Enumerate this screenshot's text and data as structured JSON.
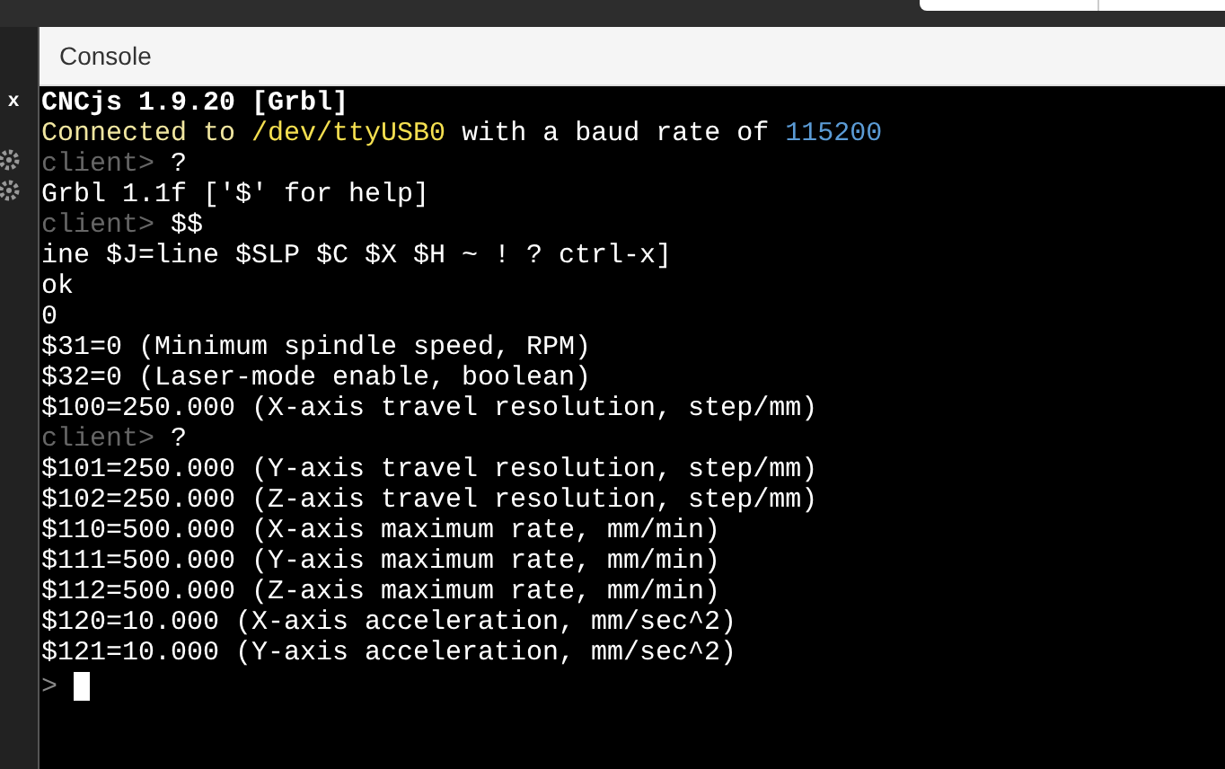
{
  "sidebar": {
    "close_label": "x"
  },
  "panel": {
    "title": "Console"
  },
  "console": {
    "lines": [
      {
        "segments": [
          {
            "kind": "banner",
            "text": "CNCjs 1.9.20 [Grbl]"
          }
        ]
      },
      {
        "segments": [
          {
            "kind": "info",
            "text": "Connected to "
          },
          {
            "kind": "path",
            "text": "/dev/ttyUSB0"
          },
          {
            "kind": "plain",
            "text": " with a baud rate of "
          },
          {
            "kind": "number",
            "text": "115200"
          }
        ]
      },
      {
        "segments": [
          {
            "kind": "prompt",
            "text": "client>"
          },
          {
            "kind": "plain",
            "text": " ?"
          }
        ]
      },
      {
        "segments": [
          {
            "kind": "plain",
            "text": "Grbl 1.1f ['$' for help]"
          }
        ]
      },
      {
        "segments": [
          {
            "kind": "prompt",
            "text": "client>"
          },
          {
            "kind": "plain",
            "text": " $$"
          }
        ]
      },
      {
        "segments": [
          {
            "kind": "plain",
            "text": "ine $J=line $SLP $C $X $H ~ ! ? ctrl-x]"
          }
        ]
      },
      {
        "segments": [
          {
            "kind": "plain",
            "text": "ok"
          }
        ]
      },
      {
        "segments": [
          {
            "kind": "plain",
            "text": "0"
          }
        ]
      },
      {
        "segments": [
          {
            "kind": "plain",
            "text": "$31=0 (Minimum spindle speed, RPM)"
          }
        ]
      },
      {
        "segments": [
          {
            "kind": "plain",
            "text": "$32=0 (Laser-mode enable, boolean)"
          }
        ]
      },
      {
        "segments": [
          {
            "kind": "plain",
            "text": "$100=250.000 (X-axis travel resolution, step/mm)"
          }
        ]
      },
      {
        "segments": [
          {
            "kind": "prompt",
            "text": "client>"
          },
          {
            "kind": "plain",
            "text": " ?"
          }
        ]
      },
      {
        "segments": [
          {
            "kind": "plain",
            "text": "$101=250.000 (Y-axis travel resolution, step/mm)"
          }
        ]
      },
      {
        "segments": [
          {
            "kind": "plain",
            "text": "$102=250.000 (Z-axis travel resolution, step/mm)"
          }
        ]
      },
      {
        "segments": [
          {
            "kind": "plain",
            "text": "$110=500.000 (X-axis maximum rate, mm/min)"
          }
        ]
      },
      {
        "segments": [
          {
            "kind": "plain",
            "text": "$111=500.000 (Y-axis maximum rate, mm/min)"
          }
        ]
      },
      {
        "segments": [
          {
            "kind": "plain",
            "text": "$112=500.000 (Z-axis maximum rate, mm/min)"
          }
        ]
      },
      {
        "segments": [
          {
            "kind": "plain",
            "text": "$120=10.000 (X-axis acceleration, mm/sec^2)"
          }
        ]
      },
      {
        "segments": [
          {
            "kind": "plain",
            "text": "$121=10.000 (Y-axis acceleration, mm/sec^2)"
          }
        ]
      }
    ],
    "input_prompt": ">"
  }
}
